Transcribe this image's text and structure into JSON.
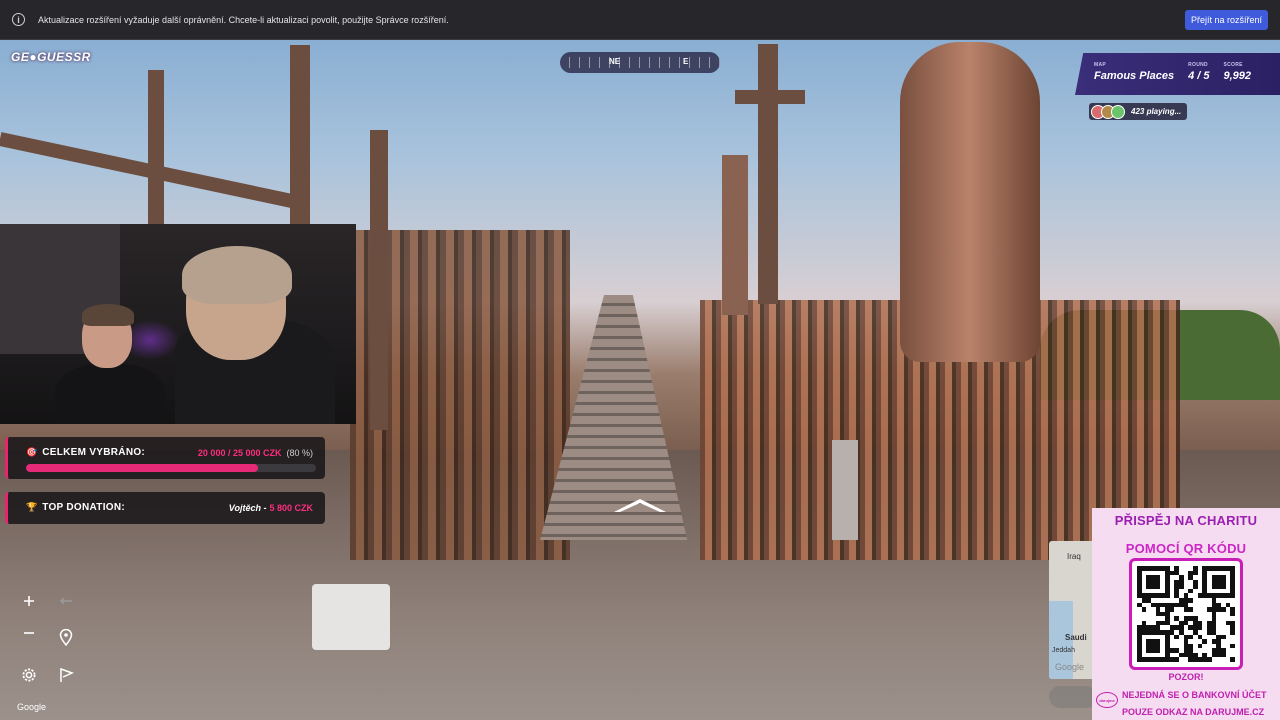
{
  "notification": {
    "text": "Aktualizace rozšíření vyžaduje další oprávnění. Chcete-li aktualizaci povolit, použijte Správce rozšíření.",
    "button_label": "Přejít na rozšíření"
  },
  "game": {
    "logo": "GE●GUESSR",
    "compass": {
      "label_ne": "NE",
      "label_e": "E"
    },
    "status": {
      "map_key": "MAP",
      "map_value": "Famous Places",
      "round_key": "ROUND",
      "round_value": "4 / 5",
      "score_key": "SCORE",
      "score_value": "9,992"
    },
    "players": {
      "label": "423 playing..."
    },
    "google_watermark": "Google"
  },
  "donations": {
    "total": {
      "title": "CELKEM VYBRÁNO:",
      "amount": "20 000 / 25 000 CZK",
      "percent_label": "(80 %)",
      "progress": 0.8
    },
    "top": {
      "title": "TOP DONATION:",
      "donor": "Vojtěch -",
      "amount": "5 800 CZK"
    }
  },
  "minimap": {
    "label_iraq": "Iraq",
    "label_saudi": "Saudi",
    "label_jeddah": "Jeddah",
    "label_google": "Google"
  },
  "charity": {
    "line1": "PŘISPĚJ NA CHARITU",
    "line2": "POMOCÍ QR KÓDU",
    "warning": "POZOR!",
    "note1": "NEJEDNÁ SE O BANKOVNÍ ÚČET",
    "note2": "POUZE ODKAZ NA DARUJME.CZ",
    "logo_text": "darujme"
  },
  "colors": {
    "accent_pink": "#e8246f",
    "panel_purple": "#2b2063",
    "charity_bg": "#f6dcf1",
    "notif_button": "#3f5bdc"
  },
  "icons": {
    "info": "info-circle-icon",
    "zoom_in": "plus-icon",
    "zoom_out": "minus-icon",
    "undo": "undo-arrow-icon",
    "pin": "map-pin-icon",
    "settings": "gear-icon",
    "flag": "flag-icon"
  }
}
